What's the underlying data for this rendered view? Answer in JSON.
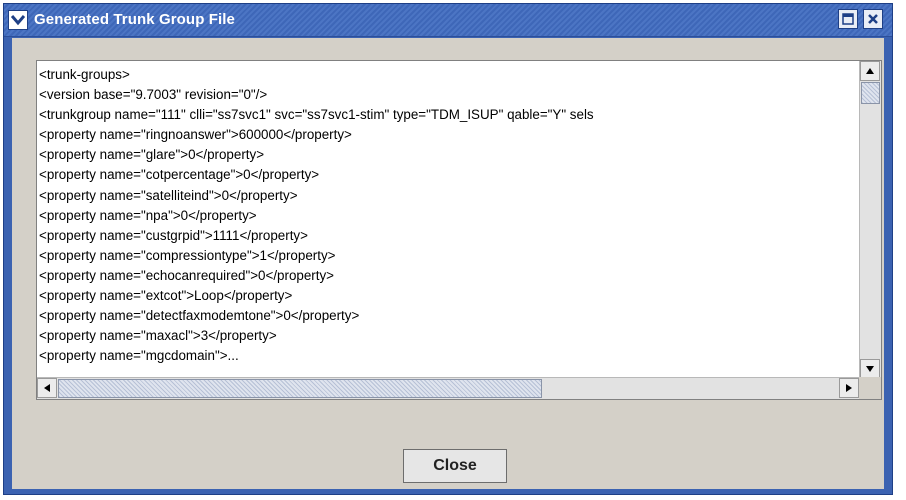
{
  "window": {
    "title": "Generated Trunk Group File",
    "close_button_label": "Close"
  },
  "textarea": {
    "lines": [
      "<trunk-groups>",
      "<version base=\"9.7003\" revision=\"0\"/>",
      "<trunkgroup name=\"111\" clli=\"ss7svc1\" svc=\"ss7svc1-stim\" type=\"TDM_ISUP\" qable=\"Y\" sels",
      "<property name=\"ringnoanswer\">600000</property>",
      "<property name=\"glare\">0</property>",
      "<property name=\"cotpercentage\">0</property>",
      "<property name=\"satelliteind\">0</property>",
      "<property name=\"npa\">0</property>",
      "<property name=\"custgrpid\">1111</property>",
      "<property name=\"compressiontype\">1</property>",
      "<property name=\"echocanrequired\">0</property>",
      "<property name=\"extcot\">Loop</property>",
      "<property name=\"detectfaxmodemtone\">0</property>",
      "<property name=\"maxacl\">3</property>",
      "<property name=\"mgcdomain\">..."
    ]
  },
  "side_code": "105581",
  "icons": {
    "window_menu": "chevron-down-icon",
    "maximize": "maximize-icon",
    "close": "close-icon",
    "scroll_up": "arrow-up-icon",
    "scroll_down": "arrow-down-icon",
    "scroll_left": "arrow-left-icon",
    "scroll_right": "arrow-right-icon"
  },
  "colors": {
    "titlebar": "#3e67b8",
    "frame": "#3b62b1",
    "dialog_bg": "#d4d0c8"
  }
}
